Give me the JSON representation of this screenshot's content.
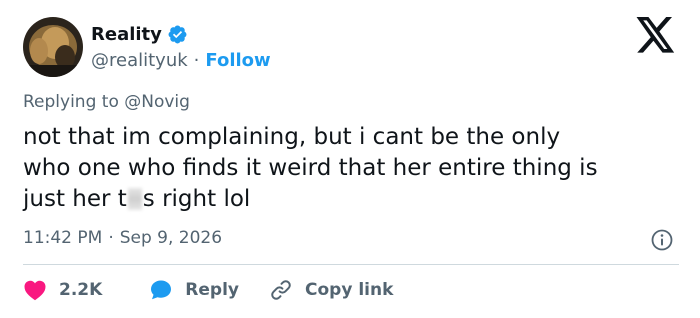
{
  "author": {
    "display_name": "Reality",
    "handle": "@realityuk",
    "separator": "·",
    "follow_label": "Follow"
  },
  "reply_context": {
    "prefix": "Replying to",
    "mention": "@Novig"
  },
  "tweet": {
    "line1": "not that im complaining, but i cant be the only",
    "line2": "who one who finds it weird that her entire thing is",
    "line3_start": "just her t",
    "line3_end": "s right lol"
  },
  "meta": {
    "time": "11:42 PM",
    "separator": "·",
    "date": "Sep 9, 2026"
  },
  "actions": {
    "like_count": "2.2K",
    "reply_label": "Reply",
    "copy_link_label": "Copy link"
  },
  "colors": {
    "accent": "#1d9bf0",
    "like": "#f91880",
    "text": "#0f1419",
    "secondary": "#536471",
    "divider": "#cfd9de"
  },
  "icons": {
    "verified": "verified-badge-icon",
    "logo": "x-logo-icon",
    "info": "info-icon",
    "like": "heart-icon",
    "reply": "speech-bubble-icon",
    "copy": "link-icon"
  }
}
